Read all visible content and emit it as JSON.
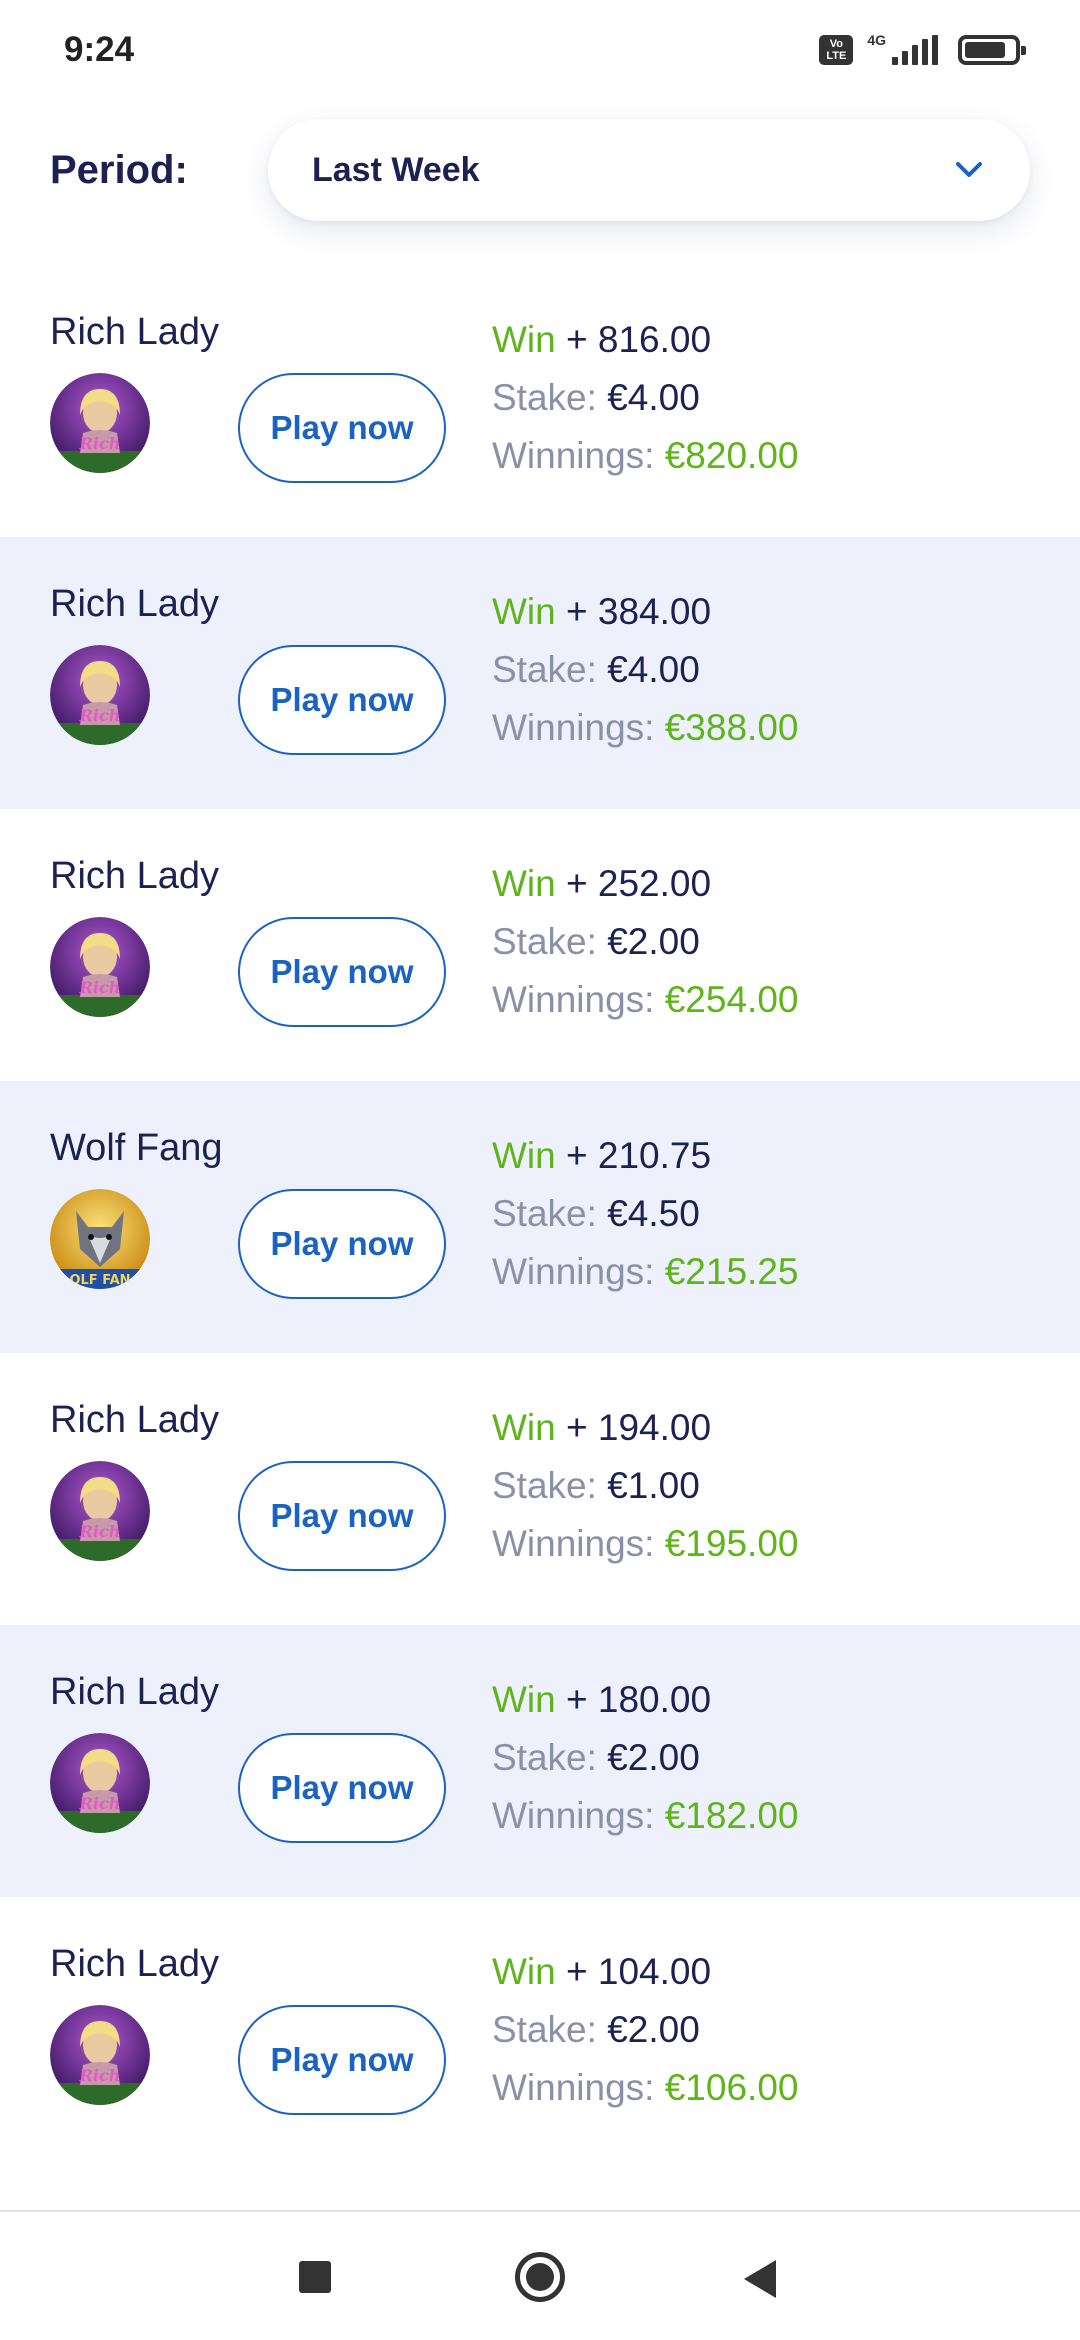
{
  "status_bar": {
    "time": "9:24",
    "volte_top": "Vo",
    "volte_bottom": "LTE",
    "network": "4G"
  },
  "period": {
    "label": "Period:",
    "selected": "Last Week"
  },
  "rows": [
    {
      "game": "Rich Lady",
      "icon": "rich-lady",
      "button": "Play now",
      "win_label": "Win",
      "win": "+ 816.00",
      "stake_label": "Stake:",
      "stake": "€4.00",
      "winnings_label": "Winnings:",
      "winnings": "€820.00"
    },
    {
      "game": "Rich Lady",
      "icon": "rich-lady",
      "button": "Play now",
      "win_label": "Win",
      "win": "+ 384.00",
      "stake_label": "Stake:",
      "stake": "€4.00",
      "winnings_label": "Winnings:",
      "winnings": "€388.00"
    },
    {
      "game": "Rich Lady",
      "icon": "rich-lady",
      "button": "Play now",
      "win_label": "Win",
      "win": "+ 252.00",
      "stake_label": "Stake:",
      "stake": "€2.00",
      "winnings_label": "Winnings:",
      "winnings": "€254.00"
    },
    {
      "game": "Wolf Fang",
      "icon": "wolf-fang",
      "button": "Play now",
      "win_label": "Win",
      "win": "+ 210.75",
      "stake_label": "Stake:",
      "stake": "€4.50",
      "winnings_label": "Winnings:",
      "winnings": "€215.25"
    },
    {
      "game": "Rich Lady",
      "icon": "rich-lady",
      "button": "Play now",
      "win_label": "Win",
      "win": "+ 194.00",
      "stake_label": "Stake:",
      "stake": "€1.00",
      "winnings_label": "Winnings:",
      "winnings": "€195.00"
    },
    {
      "game": "Rich Lady",
      "icon": "rich-lady",
      "button": "Play now",
      "win_label": "Win",
      "win": "+ 180.00",
      "stake_label": "Stake:",
      "stake": "€2.00",
      "winnings_label": "Winnings:",
      "winnings": "€182.00"
    },
    {
      "game": "Rich Lady",
      "icon": "rich-lady",
      "button": "Play now",
      "win_label": "Win",
      "win": "+ 104.00",
      "stake_label": "Stake:",
      "stake": "€2.00",
      "winnings_label": "Winnings:",
      "winnings": "€106.00"
    }
  ],
  "colors": {
    "accent": "#1a63c1",
    "win_green": "#5db51b",
    "text_dark": "#1b2150",
    "text_muted": "#8a90a8",
    "row_alt_bg": "#eef0fb"
  },
  "nav": {
    "recents_icon": "square-icon",
    "home_icon": "circle-icon",
    "back_icon": "triangle-back-icon"
  }
}
